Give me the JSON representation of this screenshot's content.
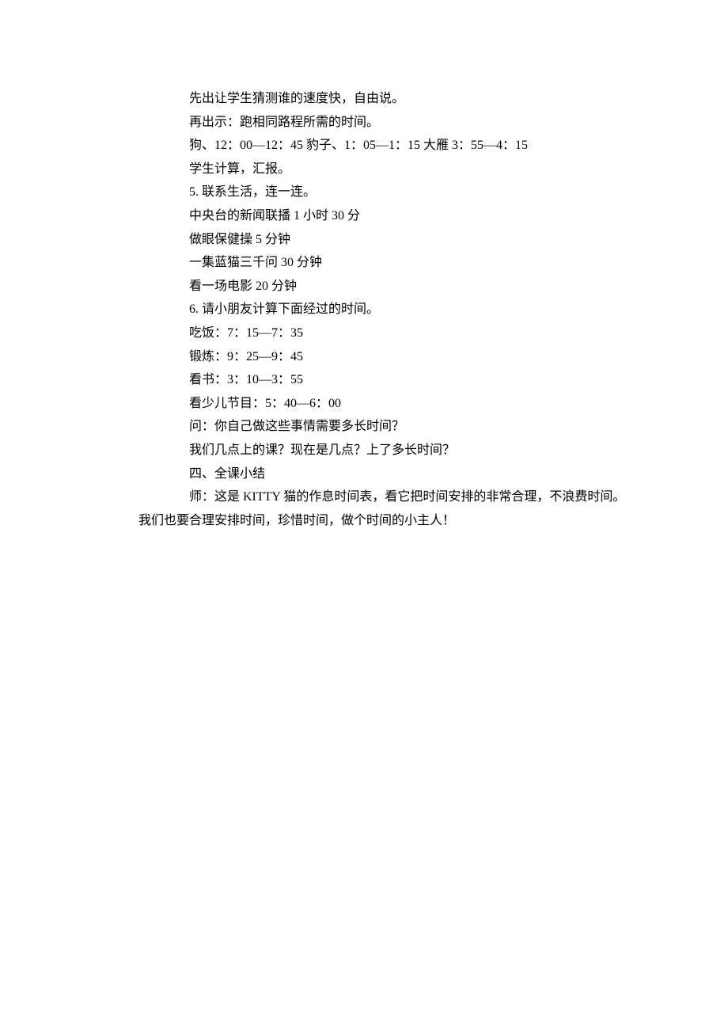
{
  "lines": [
    "先出让学生猜测谁的速度快，自由说。",
    "再出示：跑相同路程所需的时间。",
    "狗、12：00—12：45 豹子、1：05—1：15 大雁 3：55—4：15",
    "学生计算，汇报。",
    "5. 联系生活，连一连。",
    "中央台的新闻联播 1 小时 30 分",
    "做眼保健操 5 分钟",
    "一集蓝猫三千问 30 分钟",
    "看一场电影 20 分钟",
    "6. 请小朋友计算下面经过的时间。",
    "吃饭：7：15—7：35",
    "锻炼：9：25—9：45",
    "看书：3：10—3：55",
    "看少儿节目：5：40—6：00",
    "问：你自己做这些事情需要多长时间？",
    "我们几点上的课？现在是几点？上了多长时间？",
    "四、全课小结",
    "师：这是 KITTY 猫的作息时间表，看它把时间安排的非常合理，不浪费时间。"
  ],
  "last_line": "我们也要合理安排时间，珍惜时间，做个时间的小主人！"
}
